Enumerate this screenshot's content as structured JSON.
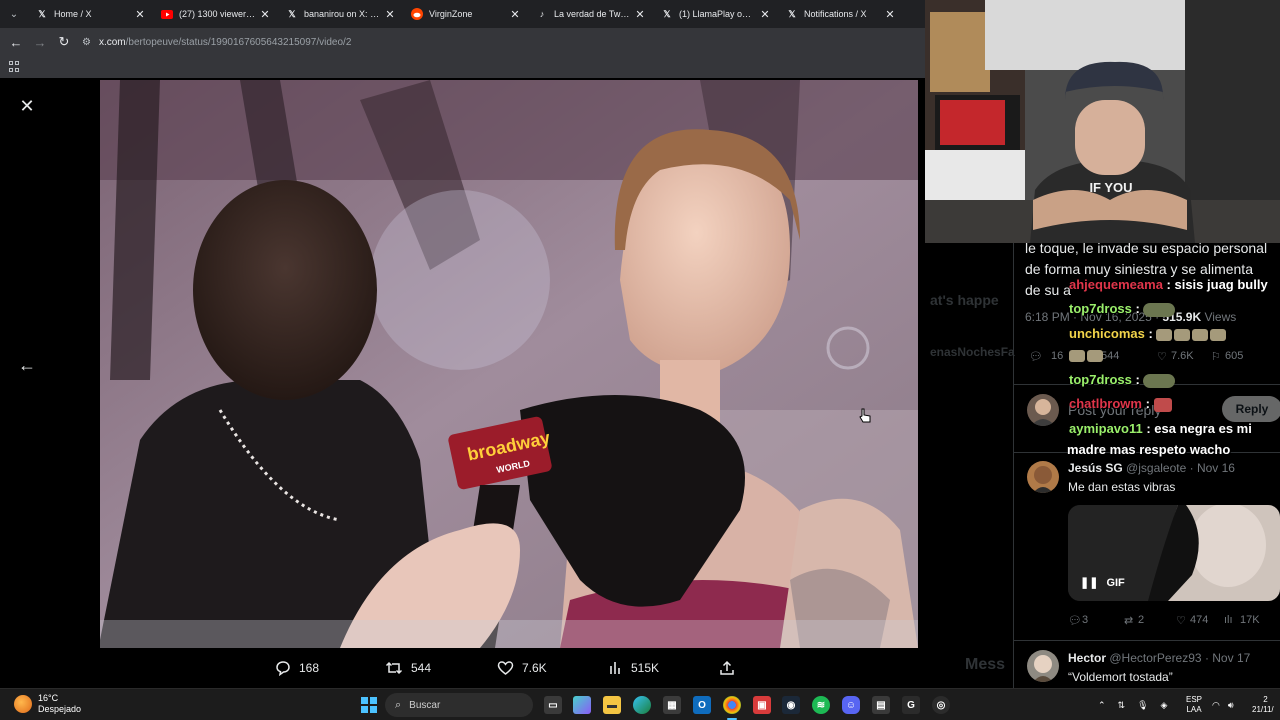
{
  "browser": {
    "tabs": [
      {
        "title": "Home / X",
        "favicon": "x-logo",
        "active": false
      },
      {
        "title": "(27) 1300 viewers po",
        "favicon": "youtube-logo",
        "active": false
      },
      {
        "title": "bananirou on X: \"http",
        "favicon": "x-logo",
        "active": false
      },
      {
        "title": "VirginZone",
        "favicon": "reddit-logo",
        "active": false
      },
      {
        "title": "La verdad de Twitch",
        "favicon": "tiktok-logo",
        "active": false
      },
      {
        "title": "(1) LlamaPlay on X: \"",
        "favicon": "x-logo",
        "active": false
      },
      {
        "title": "Notifications / X",
        "favicon": "x-logo",
        "active": false
      }
    ],
    "url_host": "x.com",
    "url_path": "/bertopeuve/status/1990167605643215097/video/2"
  },
  "video": {
    "mic_label_top": "broadway",
    "mic_label_bottom": "WORLD"
  },
  "post_actions": {
    "replies": "168",
    "reposts": "544",
    "likes": "7.6K",
    "views": "515K"
  },
  "sidebar": {
    "tweet_text_lines": [
      "le toque, le invade su espacio personal",
      "de forma muy siniestra y se alimenta",
      "de su a"
    ],
    "timestamp": "6:18 PM · Nov 16, 2025 ·",
    "views": "515.9K",
    "views_label": "Views",
    "stats": {
      "replies": "16",
      "reposts": "544",
      "likes": "7.6K",
      "bookmarks": "605"
    },
    "reply_placeholder": "Post your reply",
    "reply_button": "Reply",
    "replies": [
      {
        "name": "Jesús SG",
        "handle": "@jsgaleote",
        "date": "· Nov 16",
        "text": "Me dan estas vibras",
        "gif_label": "GIF",
        "stats": {
          "replies": "3",
          "reposts": "2",
          "likes": "474",
          "views": "17K"
        }
      },
      {
        "name": "Hector",
        "handle": "@HectorPerez93",
        "date": "· Nov 17",
        "text": "“Voldemort tostada”"
      }
    ],
    "ghost_texts": [
      "at's happe",
      "enasNochesFa",
      "Mess"
    ]
  },
  "chat": [
    {
      "user": "ahjequemeama",
      "color": "red",
      "text": " : sisis juag bully"
    },
    {
      "user": "top7dross",
      "color": "green",
      "text": " :"
    },
    {
      "user": "unchicomas",
      "color": "yellow",
      "text": " :"
    },
    {
      "user": "top7dross",
      "color": "green",
      "text": " :"
    },
    {
      "user": "chatlbrowm",
      "color": "red",
      "text": " :"
    },
    {
      "user": "aymipavo11",
      "color": "green",
      "text": " : esa negra es mi"
    },
    {
      "user": "",
      "color": "white",
      "text": "madre mas respeto wacho"
    }
  ],
  "taskbar": {
    "temperature": "16°C",
    "weather": "Despejado",
    "search_placeholder": "Buscar",
    "lang_top": "ESP",
    "lang_bottom": "LAA",
    "time": "2",
    "date": "21/11/"
  },
  "colors": {
    "x_text": "#e7e9ea",
    "x_secondary": "#71767b",
    "taskbar_accent": "#4cc2ff"
  }
}
